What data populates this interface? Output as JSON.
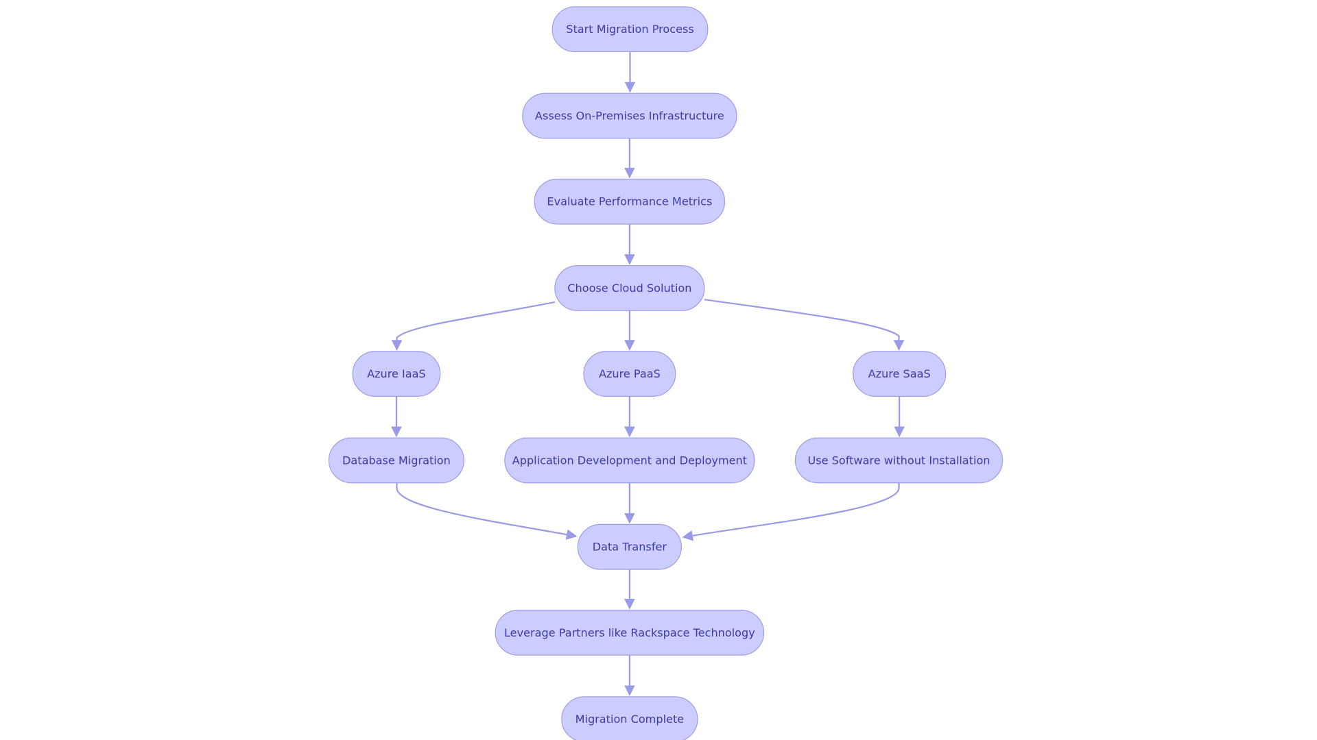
{
  "diagram": {
    "type": "flowchart",
    "direction": "top-down",
    "colors": {
      "node_fill": "#ccccff",
      "node_stroke": "#9f9fe8",
      "text": "#3b3ba8",
      "edge": "#9a9ae6"
    },
    "nodes": [
      {
        "id": "start",
        "label": "Start Migration Process"
      },
      {
        "id": "assess",
        "label": "Assess On-Premises Infrastructure"
      },
      {
        "id": "evaluate",
        "label": "Evaluate Performance Metrics"
      },
      {
        "id": "choose",
        "label": "Choose Cloud Solution"
      },
      {
        "id": "iaas",
        "label": "Azure IaaS"
      },
      {
        "id": "paas",
        "label": "Azure PaaS"
      },
      {
        "id": "saas",
        "label": "Azure SaaS"
      },
      {
        "id": "db",
        "label": "Database Migration"
      },
      {
        "id": "app",
        "label": "Application Development and Deployment"
      },
      {
        "id": "use",
        "label": "Use Software without Installation"
      },
      {
        "id": "data",
        "label": "Data Transfer"
      },
      {
        "id": "leverage",
        "label": "Leverage Partners like Rackspace Technology"
      },
      {
        "id": "complete",
        "label": "Migration Complete"
      }
    ],
    "edges": [
      {
        "from": "start",
        "to": "assess"
      },
      {
        "from": "assess",
        "to": "evaluate"
      },
      {
        "from": "evaluate",
        "to": "choose"
      },
      {
        "from": "choose",
        "to": "iaas"
      },
      {
        "from": "choose",
        "to": "paas"
      },
      {
        "from": "choose",
        "to": "saas"
      },
      {
        "from": "iaas",
        "to": "db"
      },
      {
        "from": "paas",
        "to": "app"
      },
      {
        "from": "saas",
        "to": "use"
      },
      {
        "from": "db",
        "to": "data"
      },
      {
        "from": "app",
        "to": "data"
      },
      {
        "from": "use",
        "to": "data"
      },
      {
        "from": "data",
        "to": "leverage"
      },
      {
        "from": "leverage",
        "to": "complete"
      }
    ]
  }
}
